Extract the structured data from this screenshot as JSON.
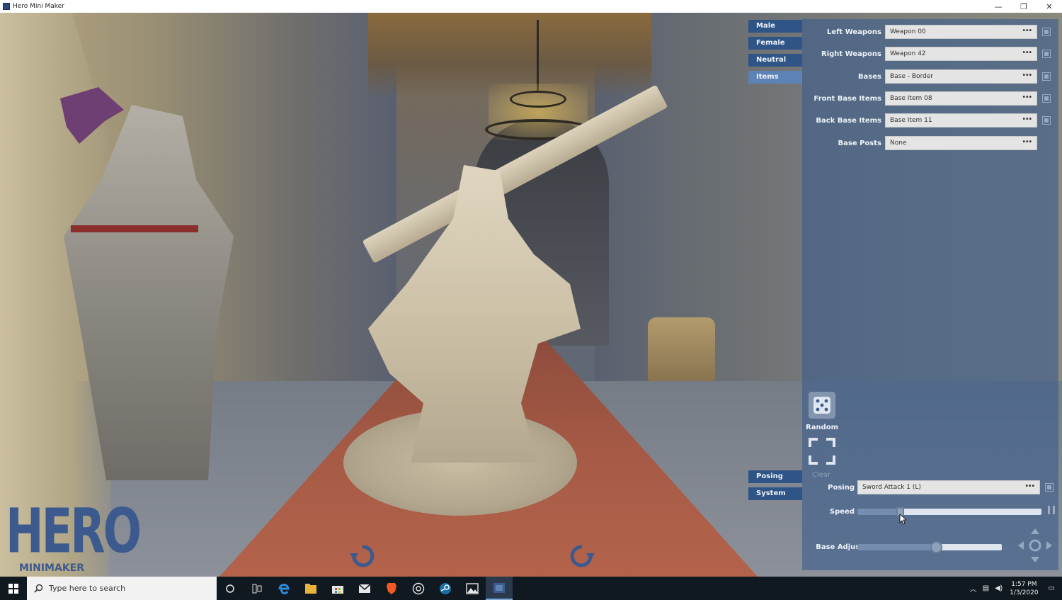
{
  "window": {
    "title": "Hero Mini Maker",
    "minimize_glyph": "—",
    "maximize_glyph": "❐",
    "close_glyph": "✕"
  },
  "logo": {
    "big": "HERO",
    "small": "MINIMAKER"
  },
  "tabs": [
    {
      "label": "Male"
    },
    {
      "label": "Female"
    },
    {
      "label": "Neutral"
    },
    {
      "label": "Items",
      "active": true
    }
  ],
  "tabs_bottom": [
    {
      "label": "Posing"
    },
    {
      "label": "System"
    }
  ],
  "item_fields": [
    {
      "label": "Left Weapons",
      "value": "Weapon 00",
      "dots": "•••"
    },
    {
      "label": "Right Weapons",
      "value": "Weapon 42",
      "dots": "•••"
    },
    {
      "label": "Bases",
      "value": "Base - Border",
      "dots": "•••"
    },
    {
      "label": "Front Base Items",
      "value": "Base Item 08",
      "dots": "•••"
    },
    {
      "label": "Back Base Items",
      "value": "Base Item 11",
      "dots": "•••"
    },
    {
      "label": "Base Posts",
      "value": "None",
      "dots": "•••"
    }
  ],
  "random": {
    "label": "Random"
  },
  "clear": {
    "label": "Clear"
  },
  "posing": {
    "label": "Posing",
    "value": "Sword Attack 1 (L)",
    "dots": "•••"
  },
  "speed": {
    "label": "Speed",
    "level": 0.2
  },
  "base_adjust": {
    "label": "Base Adjust",
    "level": 0.54
  },
  "taskbar": {
    "search_placeholder": "Type here to search",
    "time": "1:57 PM",
    "date": "1/3/2020"
  },
  "colors": {
    "panel": "#3c5e8c",
    "tab": "#2f5486",
    "tab_active": "#5d82b6",
    "logo": "#3c5a8e"
  },
  "icons": [
    "app-icon",
    "rotate-left-icon",
    "rotate-right-icon",
    "dice-icon",
    "clear-frame-icon",
    "lock-icon",
    "pause-icon",
    "dpad-icon",
    "windows-start-icon",
    "search-icon",
    "cortana-icon",
    "task-view-icon",
    "edge-icon",
    "file-explorer-icon",
    "store-icon",
    "mail-icon",
    "brave-icon",
    "chrome-icon",
    "steam-icon",
    "photos-icon",
    "hero-mini-maker-icon",
    "notification-icon"
  ]
}
